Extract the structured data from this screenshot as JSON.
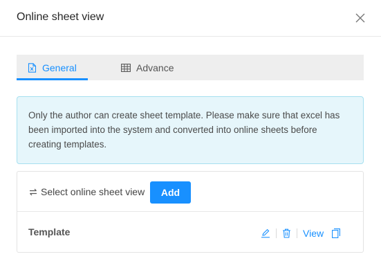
{
  "dialog": {
    "title": "Online sheet view",
    "close_icon": "close-icon"
  },
  "tabs": [
    {
      "label": "General",
      "icon": "excel-file-icon",
      "active": true
    },
    {
      "label": "Advance",
      "icon": "table-icon",
      "active": false
    }
  ],
  "alert": {
    "text": "Only the author can create sheet template. Please make sure that excel has been imported into the system and converted into online sheets before creating templates."
  },
  "panel": {
    "select_label": "Select online sheet view",
    "select_icon": "swap-icon",
    "add_label": "Add",
    "template_label": "Template",
    "actions": {
      "edit_icon": "edit-icon",
      "delete_icon": "delete-icon",
      "view_label": "View",
      "copy_icon": "copy-icon"
    }
  },
  "colors": {
    "accent": "#1890ff",
    "alert_bg": "#e6f6fb",
    "alert_border": "#a6e0f0",
    "tab_bar_bg": "#eeeeee"
  }
}
